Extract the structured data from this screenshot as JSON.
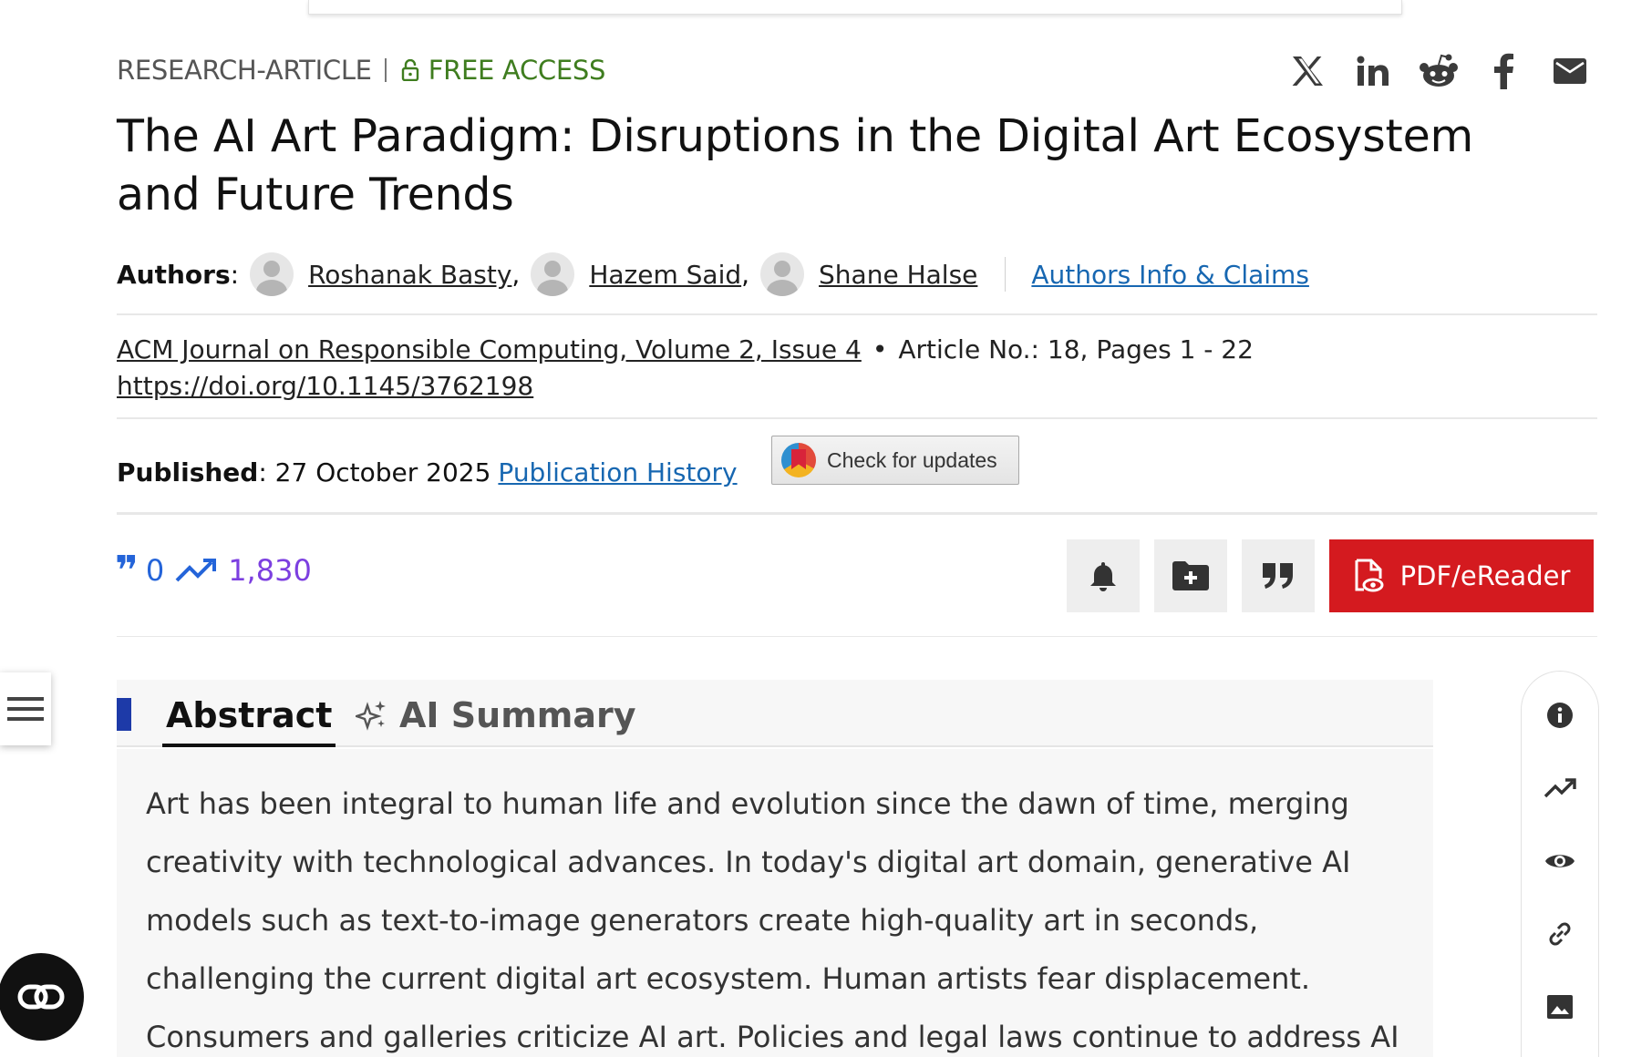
{
  "article": {
    "type": "RESEARCH-ARTICLE",
    "access": "FREE ACCESS",
    "title": "The AI Art Paradigm: Disruptions in the Digital Art Ecosystem and Future Trends",
    "authors_label": "Authors",
    "authors": [
      "Roshanak Basty",
      "Hazem Said",
      "Shane Halse"
    ],
    "authors_info": "Authors Info & Claims",
    "journal": "ACM Journal on Responsible Computing, Volume 2, Issue 4",
    "article_no": "Article No.: 18, Pages 1 - 22",
    "doi": "https://doi.org/10.1145/3762198",
    "published_label": "Published",
    "published_date": "27 October 2025",
    "publication_history": "Publication History"
  },
  "check_updates": {
    "label": "Check for updates"
  },
  "metrics": {
    "citations": "0",
    "downloads": "1,830"
  },
  "actions": {
    "pdf_label": "PDF/eReader"
  },
  "share": {
    "icons": [
      "x-icon",
      "linkedin-icon",
      "reddit-icon",
      "facebook-icon",
      "email-icon"
    ]
  },
  "tabs": {
    "abstract": "Abstract",
    "ai_summary": "AI Summary"
  },
  "abstract_text": "Art has been integral to human life and evolution since the dawn of time, merging creativity with technological advances. In today's digital art domain, generative AI models such as text-to-image generators create high-quality art in seconds, challenging the current digital art ecosystem. Human artists fear displacement. Consumers and galleries criticize AI art. Policies and legal laws continue to address AI art's ethical, social, and economic implications.",
  "colors": {
    "free_access": "#3f7d1f",
    "link": "#1767b1",
    "citations": "#2464d9",
    "downloads": "#7c3fe0",
    "pdf_button": "#d41a1f",
    "tab_marker": "#1d3aa8"
  }
}
